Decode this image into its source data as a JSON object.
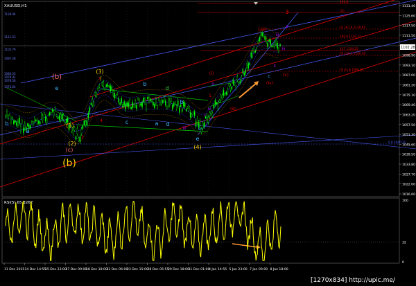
{
  "app": {
    "symbol_header": "XAUUSD,H1",
    "watermark": "[1270x834] http://upic.me/",
    "colors": {
      "background": "#000000",
      "candle": "#00ff00",
      "trend_red": "#e60000",
      "trend_blue": "#4a5cff",
      "channel_green": "#00c800",
      "rsi_line": "#ffff00",
      "highlight_arrow": "#ff9933",
      "grid": "#ffffff"
    }
  },
  "price_axis": {
    "ticks": [
      "1131.40",
      "1125.60",
      "1117.50",
      "1111.50",
      "1105.70",
      "1098.90",
      "1093.10",
      "1087.00",
      "1081.20",
      "1075.10",
      "1069.40",
      "1063.20",
      "1057.50",
      "1051.30",
      "1045.60",
      "1039.50",
      "1033.80",
      "1027.70",
      "1022.00",
      "1016.00"
    ],
    "current_price_badge": "1102.28"
  },
  "rsi_axis": {
    "label": "RSI(5) 65.3262",
    "ticks": [
      "100",
      "32",
      "0"
    ]
  },
  "time_axis": {
    "ticks": [
      "11 Dec 2015",
      "14 Dec 14:55",
      "15 Dec 23:00",
      "17 Dec 09:00",
      "18 Dec 18:00",
      "22 Dec 06:00",
      "23 Dec 15:00",
      "28 Dec 05:55",
      "29 Dec 18:00",
      "31 Dec 01:00",
      "4 Jan 14:55",
      "5 Jan 23:00",
      "7 Jan 09:00",
      "8 Jan 18:00"
    ]
  },
  "fib_levels": [
    {
      "label": "161.8",
      "color": "#e60000"
    },
    {
      "label": "(iii)",
      "color": "#e60000"
    },
    {
      "label": "FE 161.8 1118.65",
      "color": "#e60000"
    },
    {
      "label": "100.0 1110.12",
      "color": "#e60000"
    },
    {
      "label": "127 1104.25",
      "color": "#e60000"
    },
    {
      "label": "FE 100.0 1100.76",
      "color": "#e60000"
    },
    {
      "label": "FE 61.8 1090.21",
      "color": "#e60000"
    },
    {
      "label": "0.0 1040.31",
      "color": "#4a5cff"
    }
  ],
  "left_price_labels": [
    "1128.44",
    "1111.53",
    "1102.79",
    "1097.28",
    "1080.23",
    "1079.41",
    "1078.56",
    "1073.64"
  ],
  "wave_labels": [
    {
      "text": "(b)",
      "color": "#ff6a6a"
    },
    {
      "text": "e",
      "color": "#38b6ff"
    },
    {
      "text": "(3)",
      "color": "#ffd400"
    },
    {
      "text": "3",
      "color": "#e60000"
    },
    {
      "text": "b",
      "color": "#38b6ff"
    },
    {
      "text": "d",
      "color": "#38d038"
    },
    {
      "text": "b",
      "color": "#38b6ff"
    },
    {
      "text": "a",
      "color": "#38b6ff"
    },
    {
      "text": "c",
      "color": "#38b6ff"
    },
    {
      "text": "a",
      "color": "#38b6ff"
    },
    {
      "text": "d",
      "color": "#38b6ff"
    },
    {
      "text": "b",
      "color": "#38b6ff"
    },
    {
      "text": "(1)",
      "color": "#ffd400"
    },
    {
      "text": "(2)",
      "color": "#ffd400"
    },
    {
      "text": "(c)",
      "color": "#ff6a6a"
    },
    {
      "text": "(b)",
      "color": "#ffd400"
    },
    {
      "text": "2",
      "color": "#e60000"
    },
    {
      "text": "4",
      "color": "#e60000"
    },
    {
      "text": "iii",
      "color": "#b000ff"
    },
    {
      "text": "e",
      "color": "#38b6ff"
    },
    {
      "text": "(4)",
      "color": "#ffd400"
    },
    {
      "text": "(i)",
      "color": "#e60000"
    },
    {
      "text": "iv",
      "color": "#b000ff"
    },
    {
      "text": "v",
      "color": "#b000ff"
    },
    {
      "text": "(ii)",
      "color": "#e60000"
    },
    {
      "text": "(iii)",
      "color": "#e60000"
    },
    {
      "text": "(iv)",
      "color": "#e60000"
    },
    {
      "text": "3",
      "color": "#e60000"
    },
    {
      "text": "v",
      "color": "#b000ff"
    },
    {
      "text": "iii",
      "color": "#b000ff"
    },
    {
      "text": "iv",
      "color": "#b000ff"
    },
    {
      "text": "ii",
      "color": "#b000ff"
    },
    {
      "text": "a",
      "color": "#38b6ff"
    },
    {
      "text": "c",
      "color": "#38b6ff"
    },
    {
      "text": "(v)",
      "color": "#e60000"
    },
    {
      "text": "1",
      "color": "#e60000"
    },
    {
      "text": "c",
      "color": "#b000ff"
    },
    {
      "text": "e",
      "color": "#38b6ff"
    }
  ],
  "chart_data": {
    "type": "line",
    "title": "XAUUSD,H1",
    "instrument": "XAUUSD",
    "timeframe": "H1",
    "x": [
      "11 Dec 2015",
      "14 Dec 14:55",
      "15 Dec 23:00",
      "17 Dec 09:00",
      "18 Dec 18:00",
      "22 Dec 06:00",
      "23 Dec 15:00",
      "28 Dec 05:55",
      "29 Dec 18:00",
      "31 Dec 01:00",
      "4 Jan 14:55",
      "5 Jan 23:00",
      "7 Jan 09:00",
      "8 Jan 18:00"
    ],
    "series": [
      {
        "name": "XAUUSD",
        "values": [
          1072,
          1060,
          1068,
          1052,
          1081,
          1074,
          1070,
          1068,
          1070,
          1060,
          1078,
          1090,
          1111,
          1100
        ]
      },
      {
        "name": "RSI(5)",
        "values": [
          50,
          75,
          30,
          70,
          60,
          35,
          75,
          30,
          70,
          40,
          60,
          80,
          20,
          65
        ]
      }
    ],
    "ylim": [
      1012,
      1135
    ],
    "rsi_ylim": [
      0,
      100
    ],
    "rsi_levels": [
      32
    ]
  }
}
